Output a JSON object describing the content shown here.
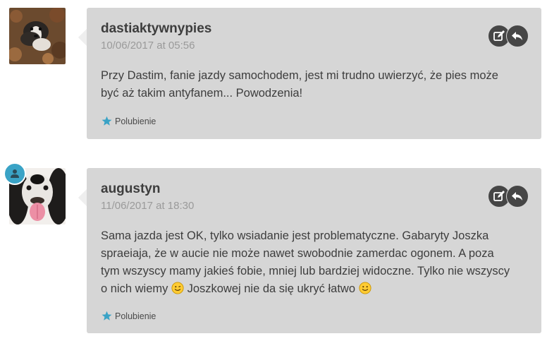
{
  "comments": [
    {
      "author": "dastiaktywnypies",
      "date": "10/06/2017 at 05:56",
      "text_lines": [
        "Przy Dastim, fanie jazdy samochodem, jest mi trudno uwierzyć, że pies może",
        "być aż takim antyfanem... Powodzenia!"
      ],
      "like_label": "Polubienie",
      "is_post_author": false
    },
    {
      "author": "augustyn",
      "date": "11/06/2017 at 18:30",
      "text_lines": [
        "Sama jazda jest OK, tylko wsiadanie jest problematyczne. Gabaryty Joszka",
        "spraeiaja, że w aucie nie może nawet swobodnie zamerdac ogonem. A poza",
        "tym wszyscy mamy jakieś fobie, mniej lub bardziej widoczne. Tylko nie wszyscy"
      ],
      "text_last_a": "o nich wiemy",
      "text_last_b": "Joszkowej nie da się ukryć łatwo",
      "like_label": "Polubienie",
      "is_post_author": true
    }
  ],
  "icons": {
    "edit": "edit-icon",
    "reply": "reply-icon",
    "like": "star-icon",
    "badge": "user-icon",
    "emoji": "smiley-emoji"
  },
  "colors": {
    "bubble": "#d6d6d6",
    "accent": "#3aa3c6",
    "action": "#464646",
    "author_text": "#3d3d3d",
    "date_text": "#9a9a9a"
  }
}
